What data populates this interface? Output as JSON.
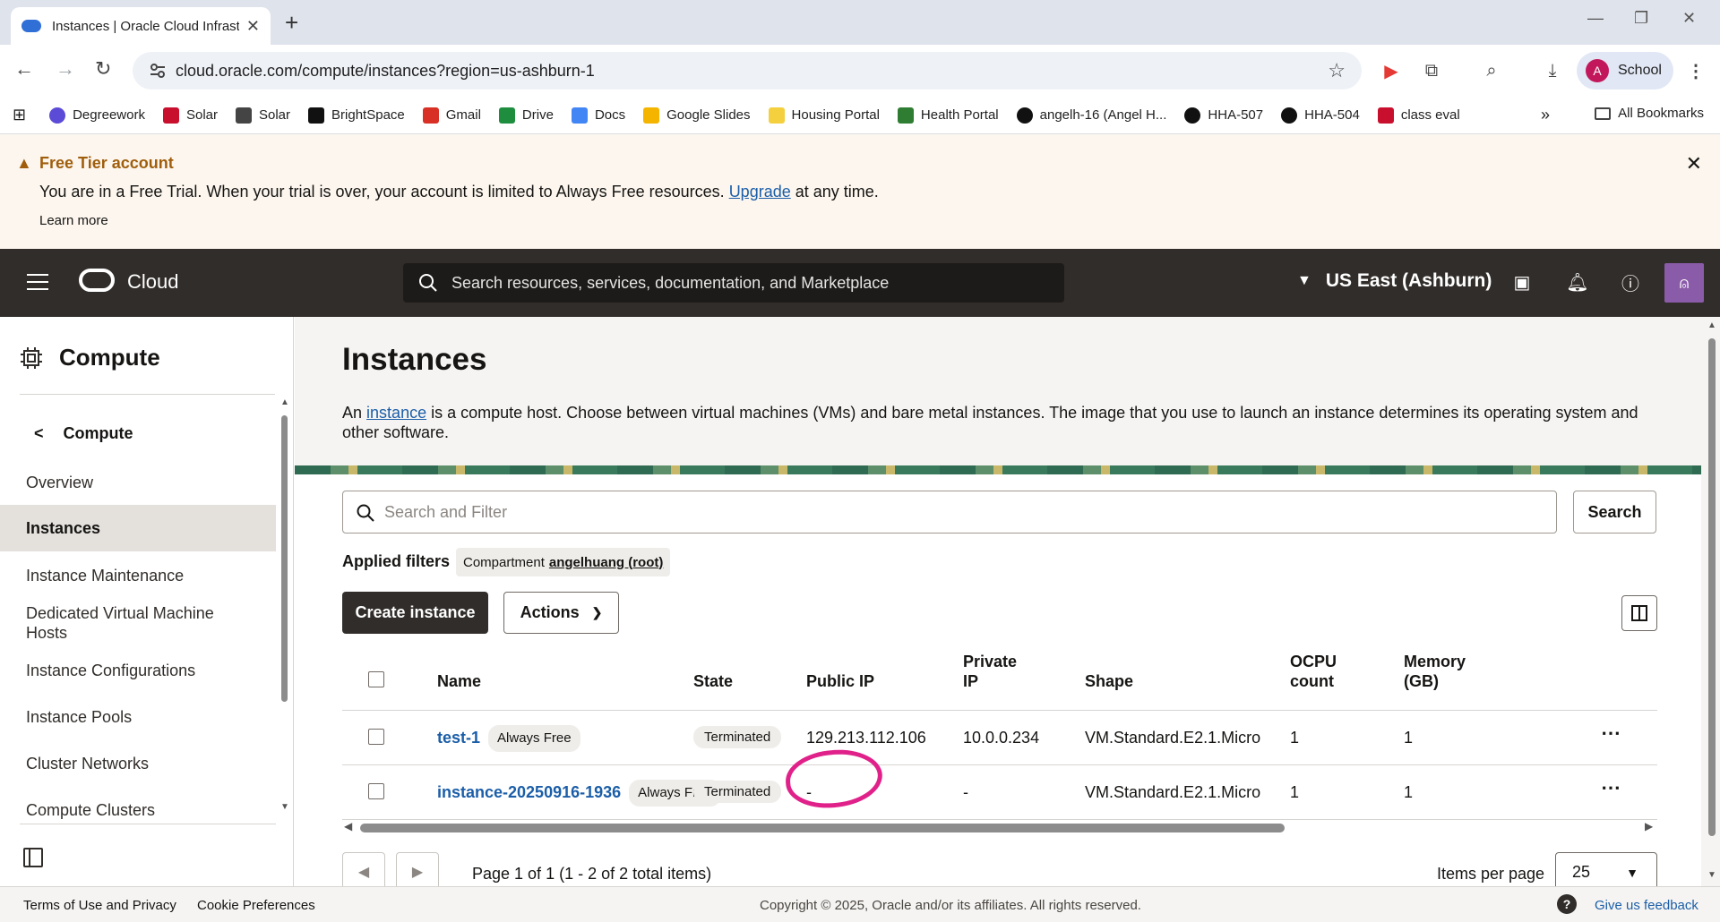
{
  "browser": {
    "tab_title": "Instances | Oracle Cloud Infrastr",
    "url": "cloud.oracle.com/compute/instances?region=us-ashburn-1",
    "profile_label": "School",
    "profile_initial": "A",
    "bookmarks": [
      {
        "label": "Degreework",
        "icon": "degreework-icon",
        "color": "#5b4bd6"
      },
      {
        "label": "Solar",
        "icon": "shield-icon",
        "color": "#c8102e"
      },
      {
        "label": "Solar",
        "icon": "folder-icon",
        "color": "#444444"
      },
      {
        "label": "BrightSpace",
        "icon": "d2l-icon",
        "color": "#111111"
      },
      {
        "label": "Gmail",
        "icon": "gmail-icon",
        "color": "#d93025"
      },
      {
        "label": "Drive",
        "icon": "drive-icon",
        "color": "#1e8e3e"
      },
      {
        "label": "Docs",
        "icon": "docs-icon",
        "color": "#4285f4"
      },
      {
        "label": "Google Slides",
        "icon": "slides-icon",
        "color": "#f4b400"
      },
      {
        "label": "Housing Portal",
        "icon": "star-icon",
        "color": "#f4d03f"
      },
      {
        "label": "Health Portal",
        "icon": "people-icon",
        "color": "#2e7d32"
      },
      {
        "label": "angelh-16 (Angel H...",
        "icon": "github-icon",
        "color": "#111111"
      },
      {
        "label": "HHA-507",
        "icon": "github-icon",
        "color": "#111111"
      },
      {
        "label": "HHA-504",
        "icon": "github-icon",
        "color": "#111111"
      },
      {
        "label": "class eval",
        "icon": "shield-icon",
        "color": "#c8102e"
      }
    ],
    "all_bookmarks": "All Bookmarks"
  },
  "banner": {
    "title": "Free Tier account",
    "message_before": "You are in a Free Trial. When your trial is over, your account is limited to Always Free resources.",
    "upgrade_link": "Upgrade",
    "message_after": "at any time.",
    "learn_more": "Learn more"
  },
  "header": {
    "brand": "Cloud",
    "search_placeholder": "Search resources, services, documentation, and Marketplace",
    "region": "US East (Ashburn)"
  },
  "leftnav": {
    "service_title": "Compute",
    "back_label": "Compute",
    "items": [
      {
        "label": "Overview",
        "active": false
      },
      {
        "label": "Instances",
        "active": true
      },
      {
        "label": "Instance Maintenance",
        "active": false
      },
      {
        "label": "Dedicated Virtual Machine Hosts",
        "active": false
      },
      {
        "label": "Instance Configurations",
        "active": false
      },
      {
        "label": "Instance Pools",
        "active": false
      },
      {
        "label": "Cluster Networks",
        "active": false
      },
      {
        "label": "Compute Clusters",
        "active": false
      }
    ]
  },
  "main": {
    "title": "Instances",
    "desc_before": "An",
    "desc_link": "instance",
    "desc_after": "is a compute host. Choose between virtual machines (VMs) and bare metal instances. The image that you use to launch an instance determines its operating system and other software.",
    "search_placeholder": "Search and Filter",
    "search_button": "Search",
    "applied_filters_label": "Applied filters",
    "filter_chip_key": "Compartment",
    "filter_chip_value": "angelhuang (root)",
    "create_button": "Create instance",
    "actions_button": "Actions",
    "table": {
      "headers": {
        "name": "Name",
        "state": "State",
        "public_ip": "Public IP",
        "private_ip_1": "Private",
        "private_ip_2": "IP",
        "shape": "Shape",
        "ocpu_1": "OCPU",
        "ocpu_2": "count",
        "memory_1": "Memory",
        "memory_2": "(GB)"
      },
      "rows": [
        {
          "name": "test-1",
          "badge": "Always Free",
          "state": "Terminated",
          "public_ip": "129.213.112.106",
          "private_ip": "10.0.0.234",
          "shape": "VM.Standard.E2.1.Micro",
          "ocpu": "1",
          "memory": "1"
        },
        {
          "name": "instance-20250916-1936",
          "badge": "Always Free",
          "state": "Terminated",
          "public_ip": "-",
          "private_ip": "-",
          "shape": "VM.Standard.E2.1.Micro",
          "ocpu": "1",
          "memory": "1"
        }
      ]
    },
    "page_info": "Page 1 of 1 (1 - 2 of 2 total items)",
    "items_per_page_label": "Items per page",
    "items_per_page_value": "25"
  },
  "footer": {
    "terms": "Terms of Use and Privacy",
    "cookies": "Cookie Preferences",
    "copyright": "Copyright © 2025, Oracle and/or its affiliates. All rights reserved.",
    "feedback": "Give us feedback"
  },
  "colors": {
    "oci_header": "#312d2a",
    "link": "#1b5ea8",
    "warning": "#a05e0c",
    "annotation": "#e0218a"
  }
}
